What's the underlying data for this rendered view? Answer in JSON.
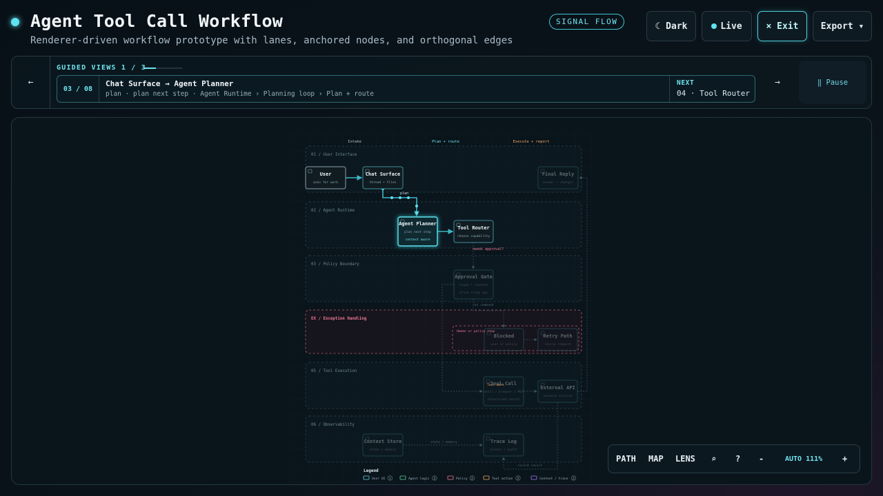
{
  "header": {
    "title": "Agent Tool Call Workflow",
    "subtitle": "Renderer-driven workflow prototype with lanes, anchored nodes, and orthogonal edges",
    "badge": "SIGNAL FLOW",
    "buttons": {
      "dark": "☾ Dark",
      "live": "Live",
      "exit": "× Exit",
      "export": "Export ▾"
    }
  },
  "guided": {
    "prev": "←",
    "label": "GUIDED VIEWS 1 / 3",
    "progress": 0.33,
    "step": "03 / 08",
    "transition": "Chat Surface → Agent Planner",
    "detail": "plan · plan next step · Agent Runtime › Planning loop › Plan + route",
    "next_label": "NEXT",
    "next_value": "04 · Tool Router",
    "forward": "→",
    "pause": "‖ Pause"
  },
  "diagram": {
    "columns": [
      "Intake",
      "Plan + route",
      "Execute + report"
    ],
    "lanes": [
      {
        "id": "ui",
        "label": "01 / User Interface"
      },
      {
        "id": "runtime",
        "label": "02 / Agent Runtime"
      },
      {
        "id": "policy",
        "label": "03 / Policy Boundary"
      },
      {
        "id": "exception",
        "label": "EX / Exception Handling"
      },
      {
        "id": "tools",
        "label": "05 / Tool Execution"
      },
      {
        "id": "observe",
        "label": "06 / Observability"
      }
    ],
    "nodes": [
      {
        "id": "user",
        "title": "User",
        "sub": "asks for work"
      },
      {
        "id": "chat",
        "title": "Chat Surface",
        "sub": "thread + files"
      },
      {
        "id": "final",
        "title": "Final Reply",
        "sub": "answer + changes"
      },
      {
        "id": "planner",
        "title": "Agent Planner",
        "sub": "plan next step",
        "tag": "context aware"
      },
      {
        "id": "router",
        "title": "Tool Router",
        "sub": "choose capability"
      },
      {
        "id": "approval",
        "title": "Approval Gate",
        "sub": "scope + consent",
        "tag": "allow risky ops"
      },
      {
        "id": "blocked",
        "title": "Blocked",
        "sub": "user or policy"
      },
      {
        "id": "retry",
        "title": "Retry Path",
        "sub": "revise request"
      },
      {
        "id": "toolcall",
        "title": "Tool Call",
        "sub": "shell / browser / MCP",
        "tag": "structured result"
      },
      {
        "id": "api",
        "title": "External API",
        "sub": "network service"
      },
      {
        "id": "context",
        "title": "Context Store",
        "sub": "state + memory"
      },
      {
        "id": "trace",
        "title": "Trace Log",
        "sub": "events + audit"
      }
    ],
    "edge_labels": {
      "plan": "plan",
      "approval": "needs approval?",
      "allowed": "run command",
      "human_stop": "Human or policy stop",
      "tool_work": "Tool work",
      "state": "state + memory",
      "record": "record result"
    },
    "legend": {
      "title": "Legend",
      "items": [
        {
          "label": "User UI",
          "count": "1",
          "color": "#5fd4e6"
        },
        {
          "label": "Agent logic",
          "count": "2",
          "color": "#58d6a6"
        },
        {
          "label": "Policy",
          "count": "2",
          "color": "#f07a93"
        },
        {
          "label": "Tool action",
          "count": "2",
          "color": "#f0a860"
        },
        {
          "label": "Context / trace",
          "count": "2",
          "color": "#a07cf0"
        }
      ]
    }
  },
  "toolbar": {
    "path": "PATH",
    "map": "MAP",
    "lens": "LENS",
    "search": "⌕",
    "help": "?",
    "zoom_out": "-",
    "zoom": "AUTO 111%",
    "zoom_in": "+"
  },
  "colors": {
    "accent": "#5fe3f0",
    "policy": "#f07a93",
    "tool": "#f0a860",
    "context": "#a07cf0"
  }
}
